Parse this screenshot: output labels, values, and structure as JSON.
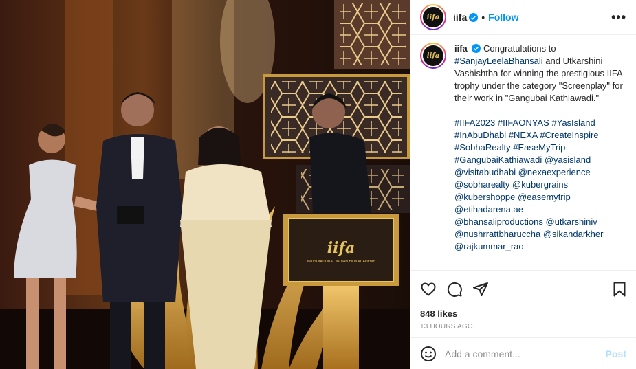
{
  "header": {
    "username": "iifa",
    "separator": "•",
    "follow_label": "Follow",
    "more_label": "•••",
    "avatar_text": "iifa"
  },
  "caption": {
    "username": "iifa",
    "text_1": "Congratulations to",
    "mention_1": "#SanjayLeelaBhansali",
    "text_2": "and Utkarshini Vashishtha for winning the prestigious IIFA trophy under the category \"Screenplay\" for their work in \"Gangubai Kathiawadi.\"",
    "hashtags": [
      "#IIFA2023 #IIFAONYAS #YasIsland",
      "#InAbuDhabi #NEXA #CreateInspire",
      "#SobhaRealty #EaseMyTrip",
      "#GangubaiKathiawadi @yasisland",
      "@visitabudhabi @nexaexperience",
      "@sobharealty @kubergrains",
      "@kubershoppe @easemytrip",
      "@etihadarena.ae",
      "@bhansaliproductions @utkarshiniv",
      "@nushrrattbharuccha @sikandarkher",
      "@rajkummar_rao"
    ]
  },
  "stats": {
    "likes": "848 likes",
    "time": "13 HOURS AGO"
  },
  "comment": {
    "placeholder": "Add a comment...",
    "post_label": "Post"
  },
  "photo": {
    "podium_logo": "iifa",
    "podium_sub": "INTERNATIONAL INDIAN FILM ACADEMY"
  },
  "colors": {
    "accent": "#0095f6",
    "link": "#00376b",
    "muted": "#8e8e8e",
    "gold": "#c99a3c"
  }
}
